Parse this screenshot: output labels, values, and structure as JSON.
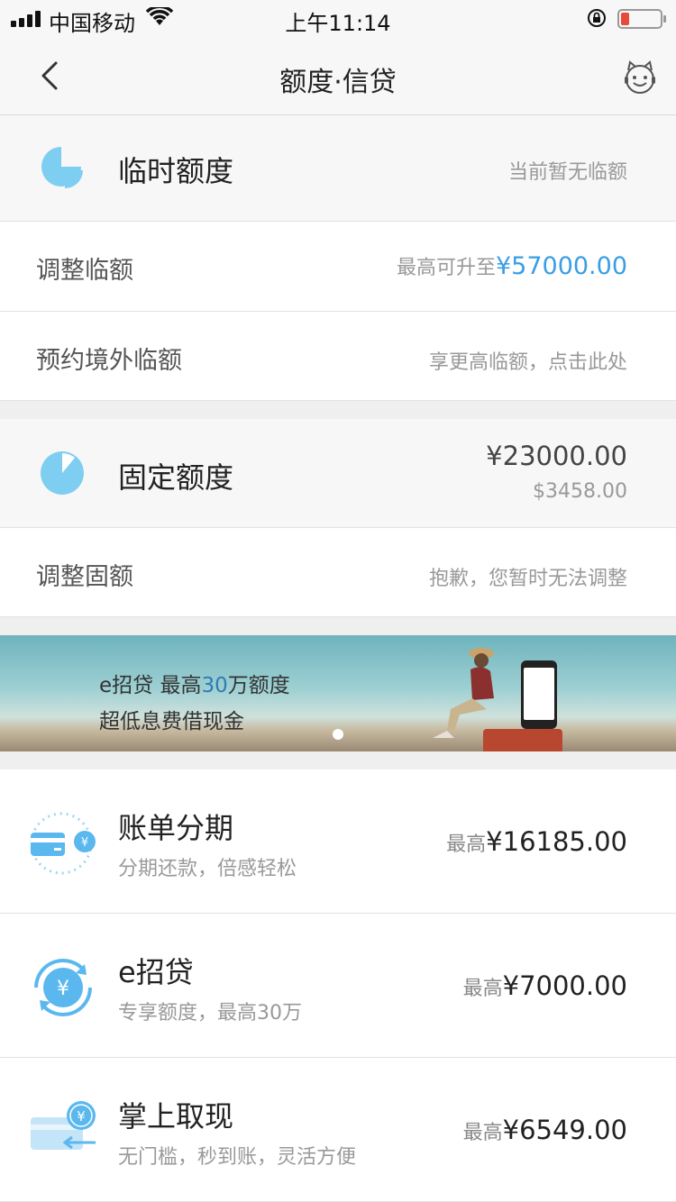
{
  "status_bar": {
    "carrier": "中国移动",
    "time": "上午11:14",
    "battery_color": "#e84a3a"
  },
  "nav": {
    "back_icon": "chevron-left-icon",
    "title": "额度·信贷",
    "service_icon": "robot-assistant-icon"
  },
  "temp_limit": {
    "title": "临时额度",
    "status": "当前暂无临额",
    "icon": "pie-chart-icon"
  },
  "adjust_temp": {
    "label": "调整临额",
    "prefix": "最高可升至",
    "amount": "¥57000.00",
    "amount_color": "#3a9ee4"
  },
  "overseas": {
    "label": "预约境外临额",
    "hint": "享更高临额，点击此处"
  },
  "fixed_limit": {
    "title": "固定额度",
    "amount_cny": "¥23000.00",
    "amount_usd": "$3458.00",
    "icon": "pie-chart-icon"
  },
  "adjust_fixed": {
    "label": "调整固额",
    "hint": "抱歉，您暂时无法调整"
  },
  "banner": {
    "line1_a": "e招贷  最高",
    "line1_hl": "30",
    "line1_b": "万额度",
    "line2": "超低息费借现金"
  },
  "products": [
    {
      "title": "账单分期",
      "subtitle": "分期还款，倍感轻松",
      "prefix": "最高",
      "amount": "¥16185.00",
      "icon": "credit-card-installment-icon"
    },
    {
      "title": "e招贷",
      "subtitle": "专享额度，最高30万",
      "prefix": "最高",
      "amount": "¥7000.00",
      "icon": "yuan-cycle-icon"
    },
    {
      "title": "掌上取现",
      "subtitle": "无门槛，秒到账，灵活方便",
      "prefix": "最高",
      "amount": "¥6549.00",
      "icon": "cash-withdraw-icon"
    }
  ]
}
